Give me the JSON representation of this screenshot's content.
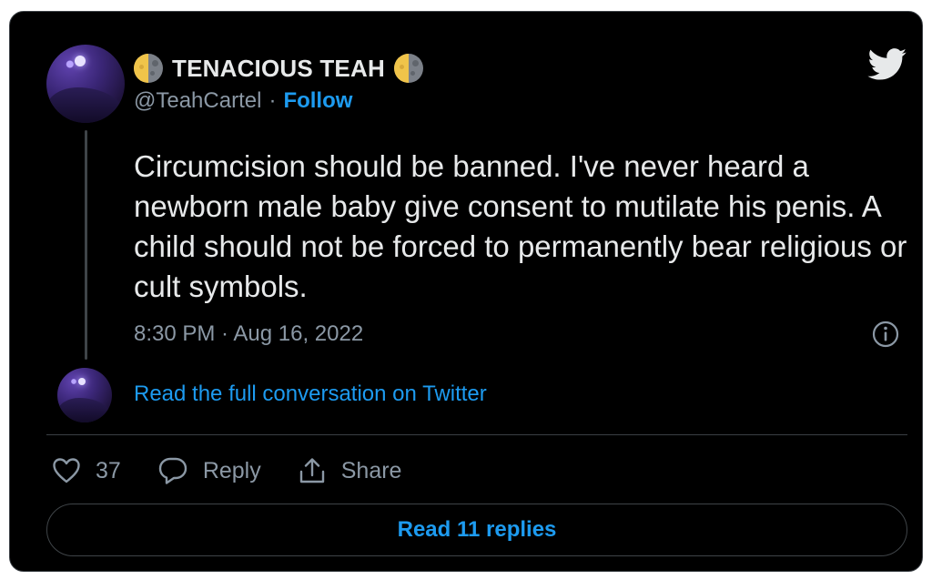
{
  "author": {
    "display_name": "TENACIOUS TEAH",
    "handle": "@TeahCartel",
    "separator": "·",
    "follow_label": "Follow",
    "name_emoji": "moon-emoji"
  },
  "tweet": {
    "text": "Circumcision should be banned. I've never heard a newborn male baby give consent to mutilate his penis. A child should not be forced to permanently bear religious or cult symbols.",
    "timestamp": "8:30 PM · Aug 16, 2022"
  },
  "conversation": {
    "read_full_label": "Read the full conversation on Twitter"
  },
  "actions": {
    "like_count": "37",
    "reply_label": "Reply",
    "share_label": "Share"
  },
  "footer": {
    "read_replies_label": "Read 11 replies"
  },
  "colors": {
    "background": "#000000",
    "accent": "#1d9bf0",
    "text": "#e7e9ea",
    "muted": "#8b98a5"
  }
}
